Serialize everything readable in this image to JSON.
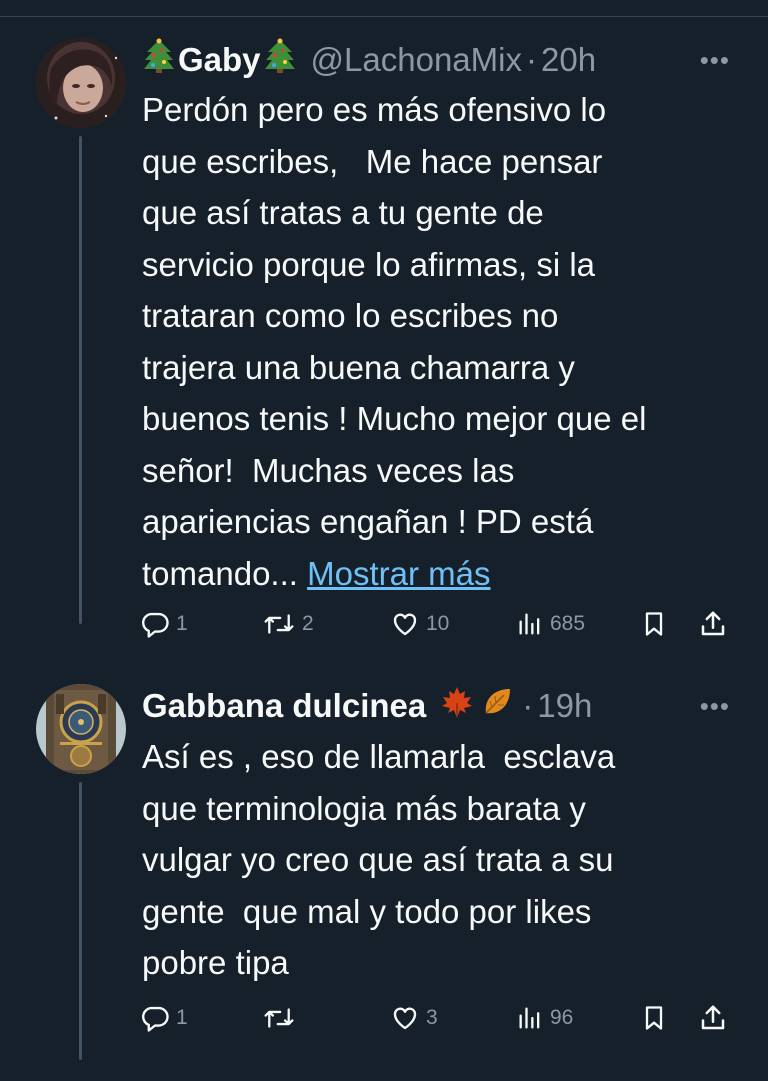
{
  "tweets": [
    {
      "display_name": "Gaby",
      "handle": "@LachonaMix",
      "separator": "·",
      "time": "20h",
      "more": "•••",
      "text_lines": [
        "Perdón pero es más ofensivo lo",
        "que escribes,   Me hace pensar",
        "que así tratas a tu gente de",
        "servicio porque lo afirmas, si la",
        "trataran como lo escribes no",
        "trajera una buena chamarra y",
        "buenos tenis ! Mucho mejor que el",
        "señor!  Muchas veces las",
        "apariencias engañan ! PD está"
      ],
      "last_line": "tomando...",
      "show_more": "Mostrar más",
      "replies": "1",
      "retweets": "2",
      "likes": "10",
      "views": "685",
      "icons": [
        "christmas-tree-icon",
        "christmas-tree-icon"
      ]
    },
    {
      "display_name": "Gabbana dulcinea",
      "handle": "",
      "separator": "·",
      "time": "19h",
      "more": "•••",
      "text_lines": [
        "Así es , eso de llamarla  esclava",
        "que terminologia más barata y",
        "vulgar yo creo que así trata a su",
        "gente  que mal y todo por likes",
        "pobre tipa"
      ],
      "replies": "1",
      "retweets": "",
      "likes": "3",
      "views": "96",
      "icons": [
        "maple-leaf-icon",
        "fallen-leaf-icon"
      ]
    }
  ],
  "colors": {
    "background": "#15202b",
    "text": "#f7f9f9",
    "muted": "#8b98a5",
    "link": "#6fc1f5",
    "thread_line": "#425364"
  }
}
